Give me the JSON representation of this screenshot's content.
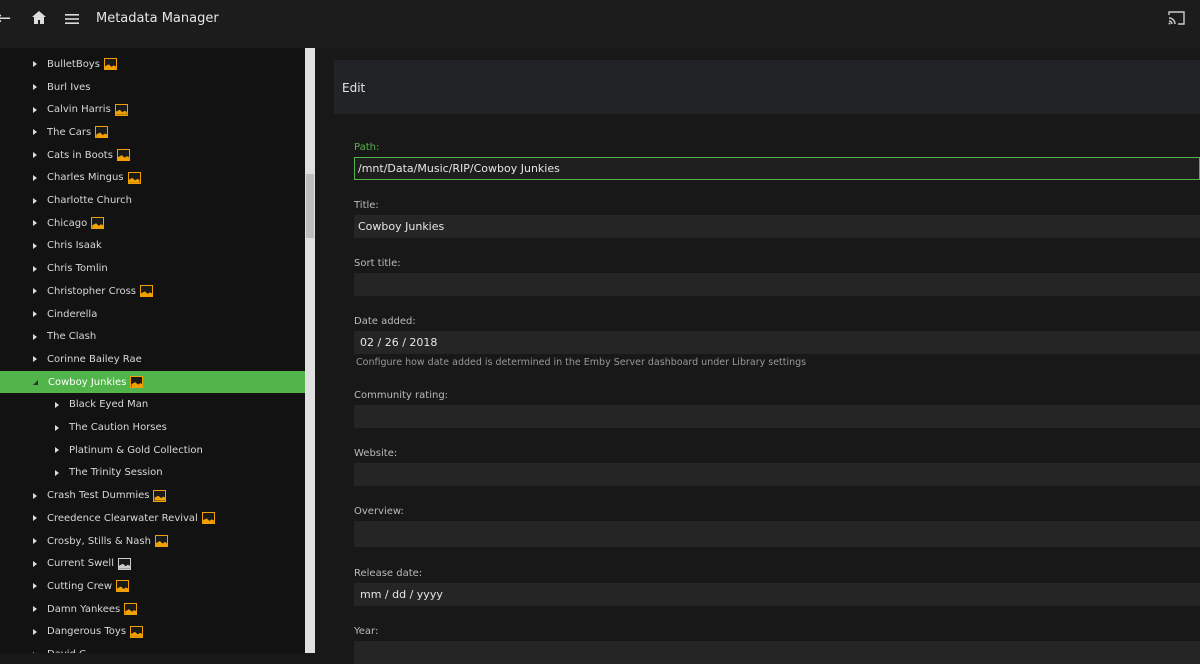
{
  "header": {
    "title": "Metadata Manager",
    "back_icon": "arrow-left",
    "home_icon": "home",
    "menu_icon": "hamburger",
    "cast_icon": "cast"
  },
  "tree": [
    {
      "label": "BulletBoys",
      "image": "orange"
    },
    {
      "label": "Burl Ives",
      "image": null
    },
    {
      "label": "Calvin Harris",
      "image": "orange"
    },
    {
      "label": "The Cars",
      "image": "orange"
    },
    {
      "label": "Cats in Boots",
      "image": "orange"
    },
    {
      "label": "Charles Mingus",
      "image": "orange"
    },
    {
      "label": "Charlotte Church",
      "image": null
    },
    {
      "label": "Chicago",
      "image": "orange"
    },
    {
      "label": "Chris Isaak",
      "image": null
    },
    {
      "label": "Chris Tomlin",
      "image": null
    },
    {
      "label": "Christopher Cross",
      "image": "orange"
    },
    {
      "label": "Cinderella",
      "image": null
    },
    {
      "label": "The Clash",
      "image": null
    },
    {
      "label": "Corinne Bailey Rae",
      "image": null
    },
    {
      "label": "Cowboy Junkies",
      "image": "orange",
      "selected": true,
      "expanded": true
    },
    {
      "label": "Black Eyed Man",
      "image": null,
      "child": true
    },
    {
      "label": "The Caution Horses",
      "image": null,
      "child": true
    },
    {
      "label": "Platinum & Gold Collection",
      "image": null,
      "child": true
    },
    {
      "label": "The Trinity Session",
      "image": null,
      "child": true
    },
    {
      "label": "Crash Test Dummies",
      "image": "orange"
    },
    {
      "label": "Creedence Clearwater Revival",
      "image": "orange"
    },
    {
      "label": "Crosby, Stills & Nash",
      "image": "orange"
    },
    {
      "label": "Current Swell",
      "image": "grey"
    },
    {
      "label": "Cutting Crew",
      "image": "orange"
    },
    {
      "label": "Damn Yankees",
      "image": "orange"
    },
    {
      "label": "Dangerous Toys",
      "image": "orange"
    },
    {
      "label": "David C",
      "image": null
    }
  ],
  "edit": {
    "heading": "Edit",
    "path_label": "Path:",
    "path_value": "/mnt/Data/Music/RIP/Cowboy Junkies",
    "title_label": "Title:",
    "title_value": "Cowboy Junkies",
    "sort_title_label": "Sort title:",
    "sort_title_value": "",
    "date_added_label": "Date added:",
    "date_added_value": "02 / 26 / 2018",
    "date_added_help": "Configure how date added is determined in the Emby Server dashboard under Library settings",
    "community_rating_label": "Community rating:",
    "community_rating_value": "",
    "website_label": "Website:",
    "website_value": "",
    "overview_label": "Overview:",
    "overview_value": "",
    "release_date_label": "Release date:",
    "release_date_value": "mm / dd / yyyy",
    "year_label": "Year:",
    "year_value": ""
  },
  "colors": {
    "accent": "#52b54b",
    "image_badge": "#f0a000"
  }
}
